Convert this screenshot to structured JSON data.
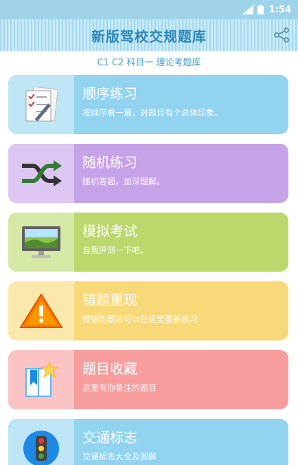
{
  "status": {
    "time": "1:54"
  },
  "app": {
    "title": "新版驾校交规题库",
    "subtitle": "C1 C2 科目一 理论考题库"
  },
  "cards": [
    {
      "title": "顺序练习",
      "desc": "按顺序看一遍，对题目有个总体印象。",
      "icon": "checklist-pen-icon"
    },
    {
      "title": "随机练习",
      "desc": "随机答题，加深理解。",
      "icon": "shuffle-icon"
    },
    {
      "title": "模拟考试",
      "desc": "自我评测一下吧。",
      "icon": "monitor-icon"
    },
    {
      "title": "错题重现",
      "desc": "做错的题目可以在这里重新练习",
      "icon": "warning-icon"
    },
    {
      "title": "题目收藏",
      "desc": "这里有你备注的题目",
      "icon": "bookmark-star-icon"
    },
    {
      "title": "交通标志",
      "desc": "交通标志大全及图解",
      "icon": "traffic-light-icon"
    }
  ],
  "colors": {
    "status_bar": "#9fd3e8",
    "title_text": "#2f86b9",
    "card_blue": "#92d3ef",
    "card_purple": "#c6a3e8",
    "card_green": "#bcd86d",
    "card_yellow": "#f8d979",
    "card_red": "#f79d9d"
  }
}
